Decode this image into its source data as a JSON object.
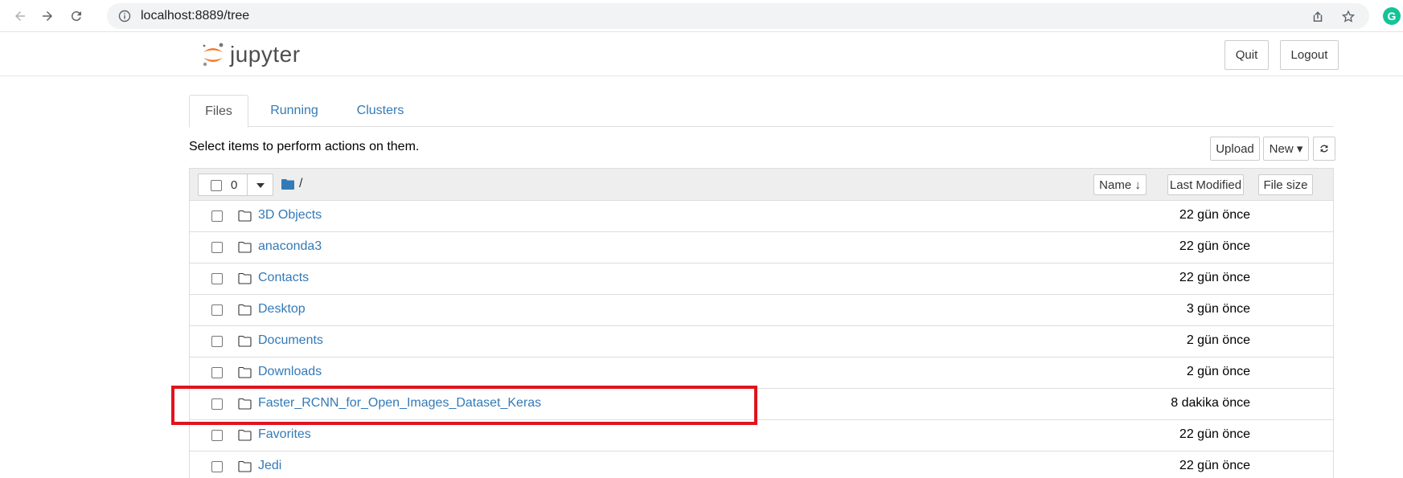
{
  "browser": {
    "url": "localhost:8889/tree",
    "grammarly_letter": "G"
  },
  "header": {
    "logo_text": "jupyter",
    "quit_label": "Quit",
    "logout_label": "Logout"
  },
  "tabs": [
    {
      "label": "Files",
      "active": true
    },
    {
      "label": "Running",
      "active": false
    },
    {
      "label": "Clusters",
      "active": false
    }
  ],
  "toolbar": {
    "hint": "Select items to perform actions on them.",
    "upload_label": "Upload",
    "new_label": "New ▾",
    "refresh_icon": "refresh-icon"
  },
  "list_header": {
    "selected_count": "0",
    "path": "/",
    "name_label": "Name ↓",
    "last_modified_label": "Last Modified",
    "file_size_label": "File size"
  },
  "files": [
    {
      "name": "3D Objects",
      "modified": "22 gün önce"
    },
    {
      "name": "anaconda3",
      "modified": "22 gün önce"
    },
    {
      "name": "Contacts",
      "modified": "22 gün önce"
    },
    {
      "name": "Desktop",
      "modified": "3 gün önce"
    },
    {
      "name": "Documents",
      "modified": "2 gün önce"
    },
    {
      "name": "Downloads",
      "modified": "2 gün önce"
    },
    {
      "name": "Faster_RCNN_for_Open_Images_Dataset_Keras",
      "modified": "8 dakika önce",
      "highlighted": true
    },
    {
      "name": "Favorites",
      "modified": "22 gün önce"
    },
    {
      "name": "Jedi",
      "modified": "22 gün önce"
    }
  ],
  "colors": {
    "link": "#337ab7",
    "highlight": "#e0141e",
    "jupyter_orange": "#f37726"
  }
}
